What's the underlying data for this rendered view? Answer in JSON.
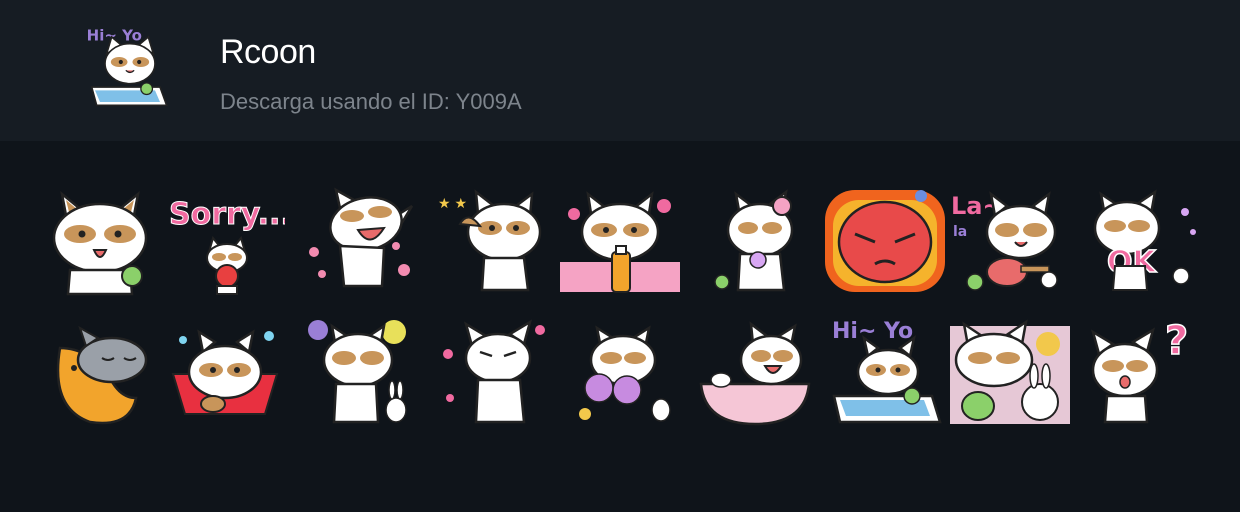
{
  "header": {
    "title": "Rcoon",
    "subtitle": "Descarga usando el ID: Y009A",
    "thumbnail_icon": "raccoon-hi-yo-laptop"
  },
  "colors": {
    "page_bg": "#0f141a",
    "header_bg": "#161c23",
    "title": "#ffffff",
    "subtitle": "#7d848c"
  },
  "stickers": {
    "sorry_text": "Sorry...",
    "lala_text": "La~",
    "lala_small": "la",
    "ok_text": "OK",
    "hiyo_text": "Hi~ Yo",
    "question_text": "?"
  }
}
